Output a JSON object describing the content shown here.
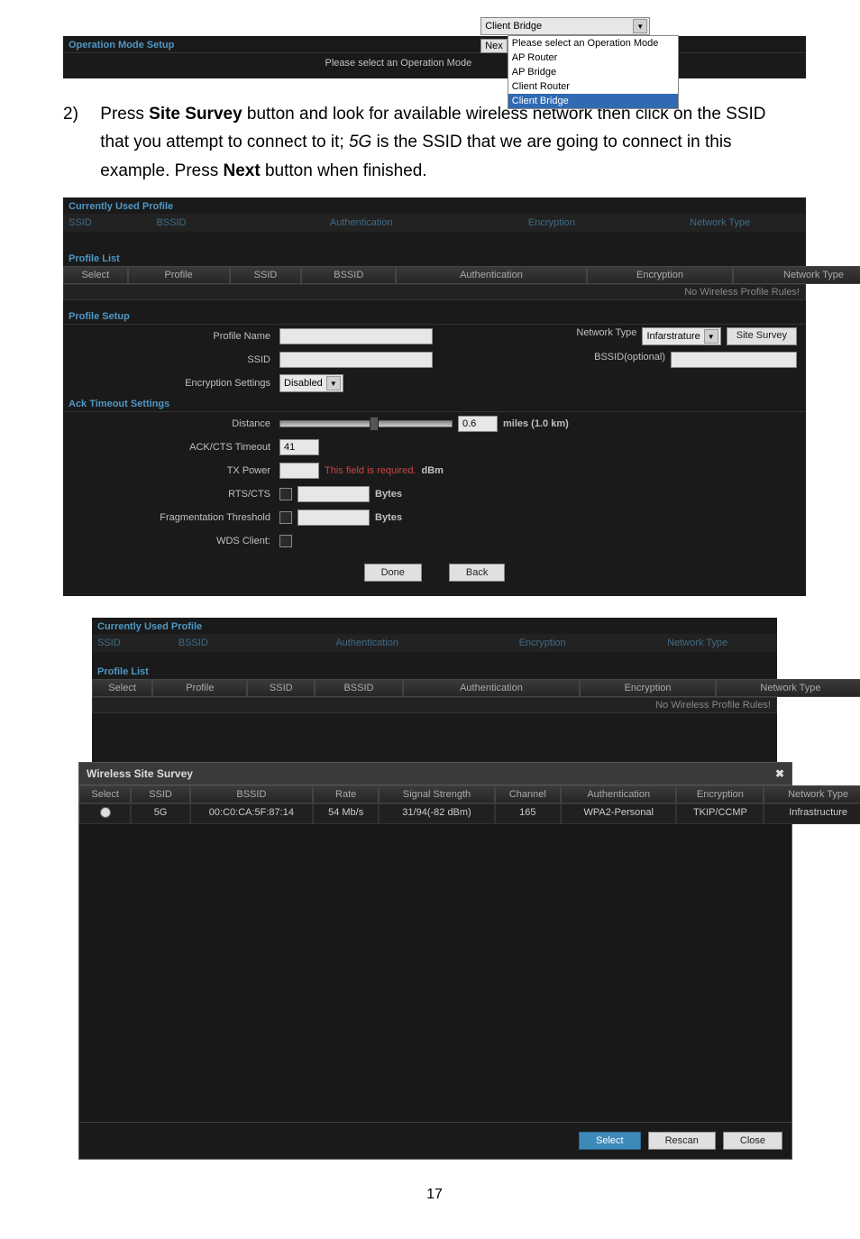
{
  "op_mode_setup": {
    "title": "Operation Mode Setup",
    "label": "Please select an Operation Mode",
    "value": "Client Bridge",
    "next": "Nex",
    "options": [
      "Please select an Operation Mode",
      "AP Router",
      "AP Bridge",
      "Client Router",
      "Client Bridge"
    ]
  },
  "instruction": {
    "num": "2)",
    "text_before": "Press ",
    "bold1": "Site Survey",
    "text_mid1": " button and look for available wireless network then click on the SSID that you attempt to connect to it; ",
    "italic": "5G",
    "text_mid2": " is the SSID that we are going to connect in this example. Press ",
    "bold2": "Next",
    "text_end": " button when finished."
  },
  "currently_used": {
    "title": "Currently Used Profile",
    "cols": [
      "SSID",
      "BSSID",
      "Authentication",
      "Encryption",
      "Network Type"
    ]
  },
  "profile_list": {
    "title": "Profile List",
    "cols": [
      "Select",
      "Profile",
      "SSID",
      "BSSID",
      "Authentication",
      "Encryption",
      "Network Type"
    ],
    "empty": "No Wireless Profile Rules!"
  },
  "profile_setup": {
    "title": "Profile Setup",
    "profile_name": "Profile Name",
    "network_type": "Network Type",
    "network_type_val": "Infarstrature",
    "site_survey": "Site Survey",
    "ssid": "SSID",
    "bssid_opt": "BSSID(optional)",
    "enc_settings": "Encryption Settings",
    "enc_val": "Disabled"
  },
  "ack": {
    "title": "Ack Timeout Settings",
    "distance": "Distance",
    "distance_val": "0.6",
    "distance_unit": "miles (1.0 km)",
    "ackcts": "ACK/CTS Timeout",
    "ackcts_val": "41",
    "txpower": "TX Power",
    "txpower_req": "This field is required.",
    "txpower_unit": "dBm",
    "rtscts": "RTS/CTS",
    "bytes": "Bytes",
    "frag": "Fragmentation Threshold",
    "wds": "WDS Client:",
    "done": "Done",
    "back": "Back"
  },
  "popup": {
    "title": "Wireless Site Survey",
    "close_x": "✖",
    "cols": [
      "Select",
      "SSID",
      "BSSID",
      "Rate",
      "Signal Strength",
      "Channel",
      "Authentication",
      "Encryption",
      "Network Type"
    ],
    "row": {
      "ssid": "5G",
      "bssid": "00:C0:CA:5F:87:14",
      "rate": "54 Mb/s",
      "signal": "31/94(-82 dBm)",
      "channel": "165",
      "auth": "WPA2-Personal",
      "enc": "TKIP/CCMP",
      "ntype": "Infrastructure"
    },
    "select": "Select",
    "rescan": "Rescan",
    "close": "Close"
  },
  "pagenum": "17"
}
